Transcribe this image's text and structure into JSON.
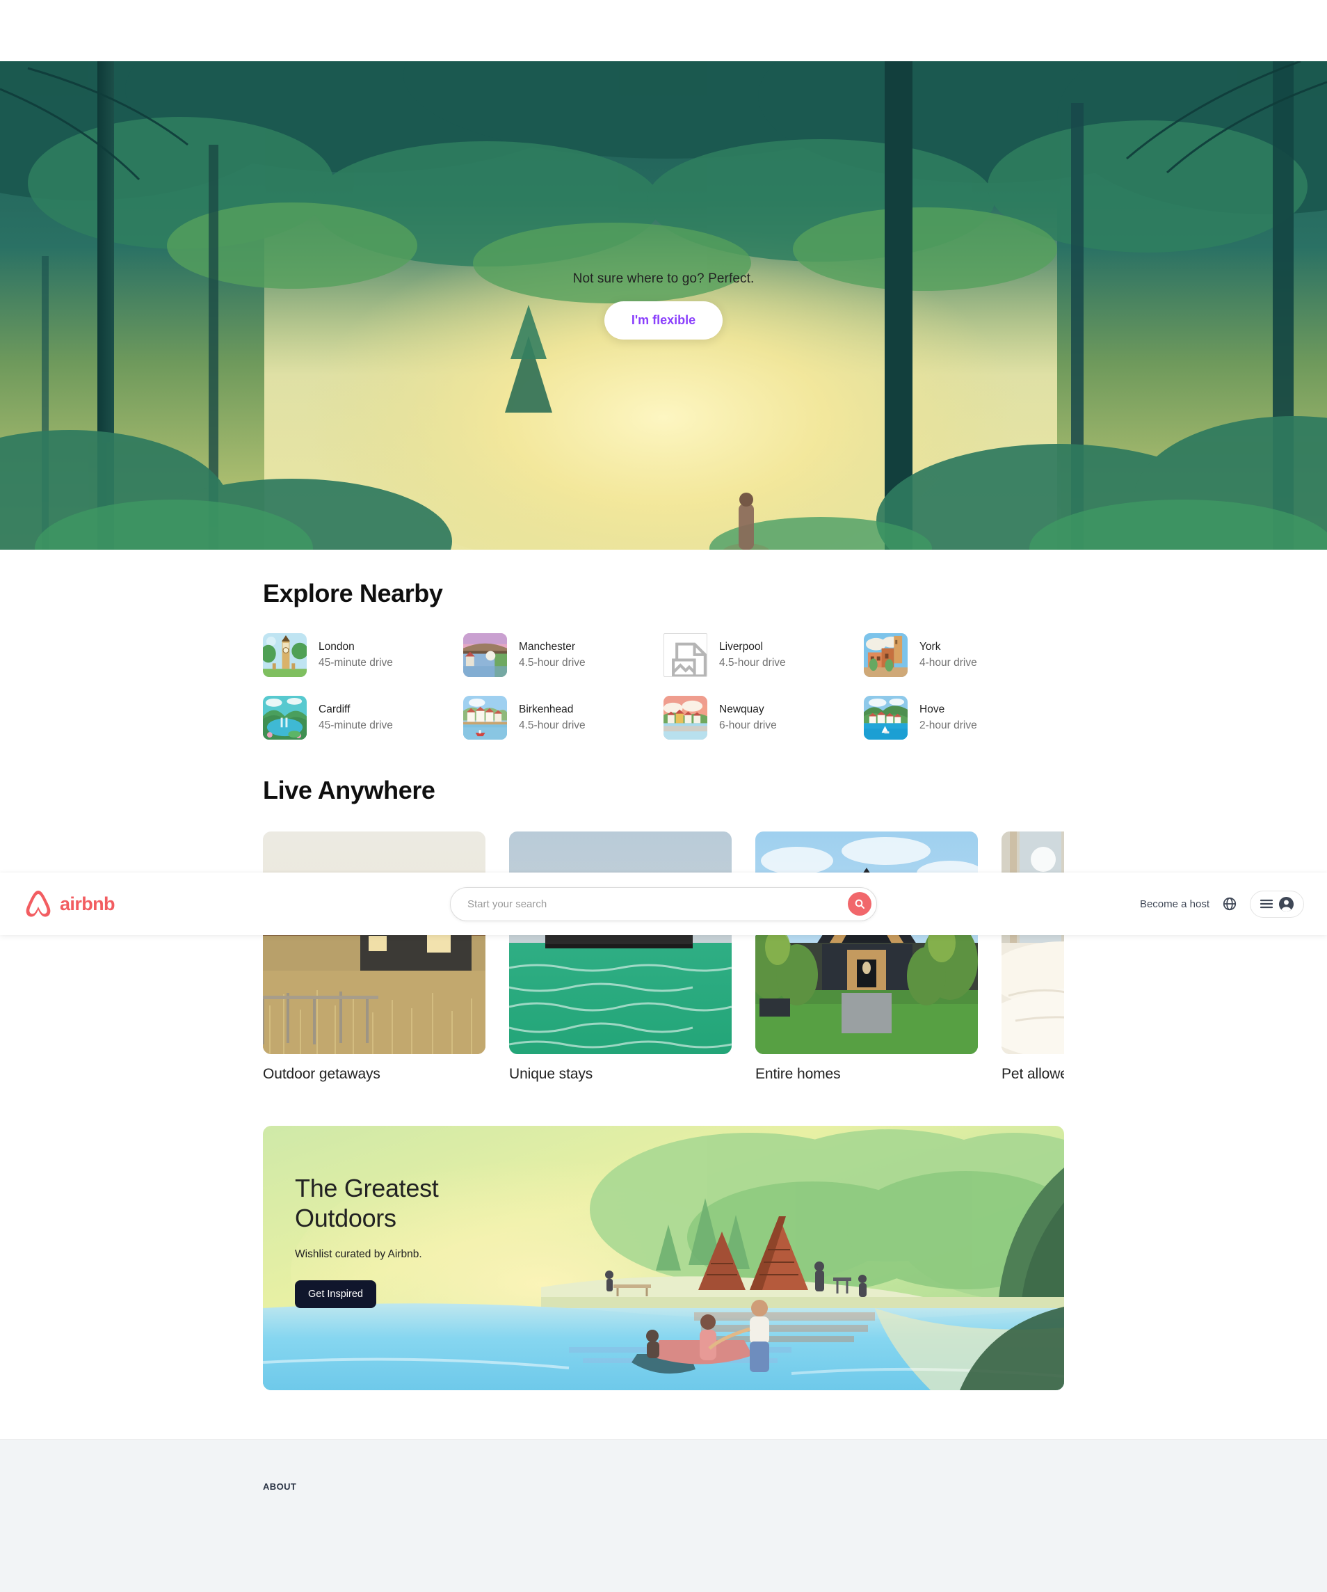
{
  "hero": {
    "caption": "Not sure where to go? Perfect.",
    "button_label": "I'm flexible",
    "button_text_color": "#8a3ffc",
    "image_name": "forest-sunbeam-illustration"
  },
  "navbar": {
    "brand": "airbnb",
    "brand_color": "#f25d61",
    "logo_icon": "airbnb-bowtie-logo",
    "search": {
      "placeholder": "Start your search",
      "value": "",
      "button_icon": "search-icon",
      "button_color": "#f1676b"
    },
    "become_host_label": "Become a host",
    "globe_icon": "globe-icon",
    "menu_icon": "hamburger-icon",
    "avatar_icon": "user-avatar-icon"
  },
  "explore": {
    "title": "Explore Nearby",
    "items": [
      {
        "name": "London",
        "distance": "45-minute drive",
        "icon": "big-ben-thumbnail",
        "broken": false
      },
      {
        "name": "Manchester",
        "distance": "4.5-hour drive",
        "icon": "bridge-thumbnail",
        "broken": false
      },
      {
        "name": "Liverpool",
        "distance": "4.5-hour drive",
        "icon": "broken-image-icon",
        "broken": true
      },
      {
        "name": "York",
        "distance": "4-hour drive",
        "icon": "old-town-thumbnail",
        "broken": false
      },
      {
        "name": "Cardiff",
        "distance": "45-minute drive",
        "icon": "lake-hills-thumbnail",
        "broken": false
      },
      {
        "name": "Birkenhead",
        "distance": "4.5-hour drive",
        "icon": "harbour-thumbnail",
        "broken": false
      },
      {
        "name": "Newquay",
        "distance": "6-hour drive",
        "icon": "seaside-thumbnail",
        "broken": false
      },
      {
        "name": "Hove",
        "distance": "2-hour drive",
        "icon": "bay-village-thumbnail",
        "broken": false
      }
    ]
  },
  "live_anywhere": {
    "title": "Live Anywhere",
    "cards": [
      {
        "label": "Outdoor getaways",
        "image_name": "cabin-in-dry-grass-photo"
      },
      {
        "label": "Unique stays",
        "image_name": "floating-house-on-green-water-photo"
      },
      {
        "label": "Entire homes",
        "image_name": "a-frame-house-with-lawn-photo"
      },
      {
        "label": "Pet allowed",
        "image_name": "bed-with-dog-photo"
      }
    ]
  },
  "banner": {
    "title_line1": "The Greatest",
    "title_line2": "Outdoors",
    "subtitle": "Wishlist curated by Airbnb.",
    "button_label": "Get Inspired",
    "button_color": "#10162c",
    "image_name": "lakeside-camping-illustration"
  },
  "footer": {
    "columns": [
      {
        "title": "ABOUT"
      }
    ]
  }
}
